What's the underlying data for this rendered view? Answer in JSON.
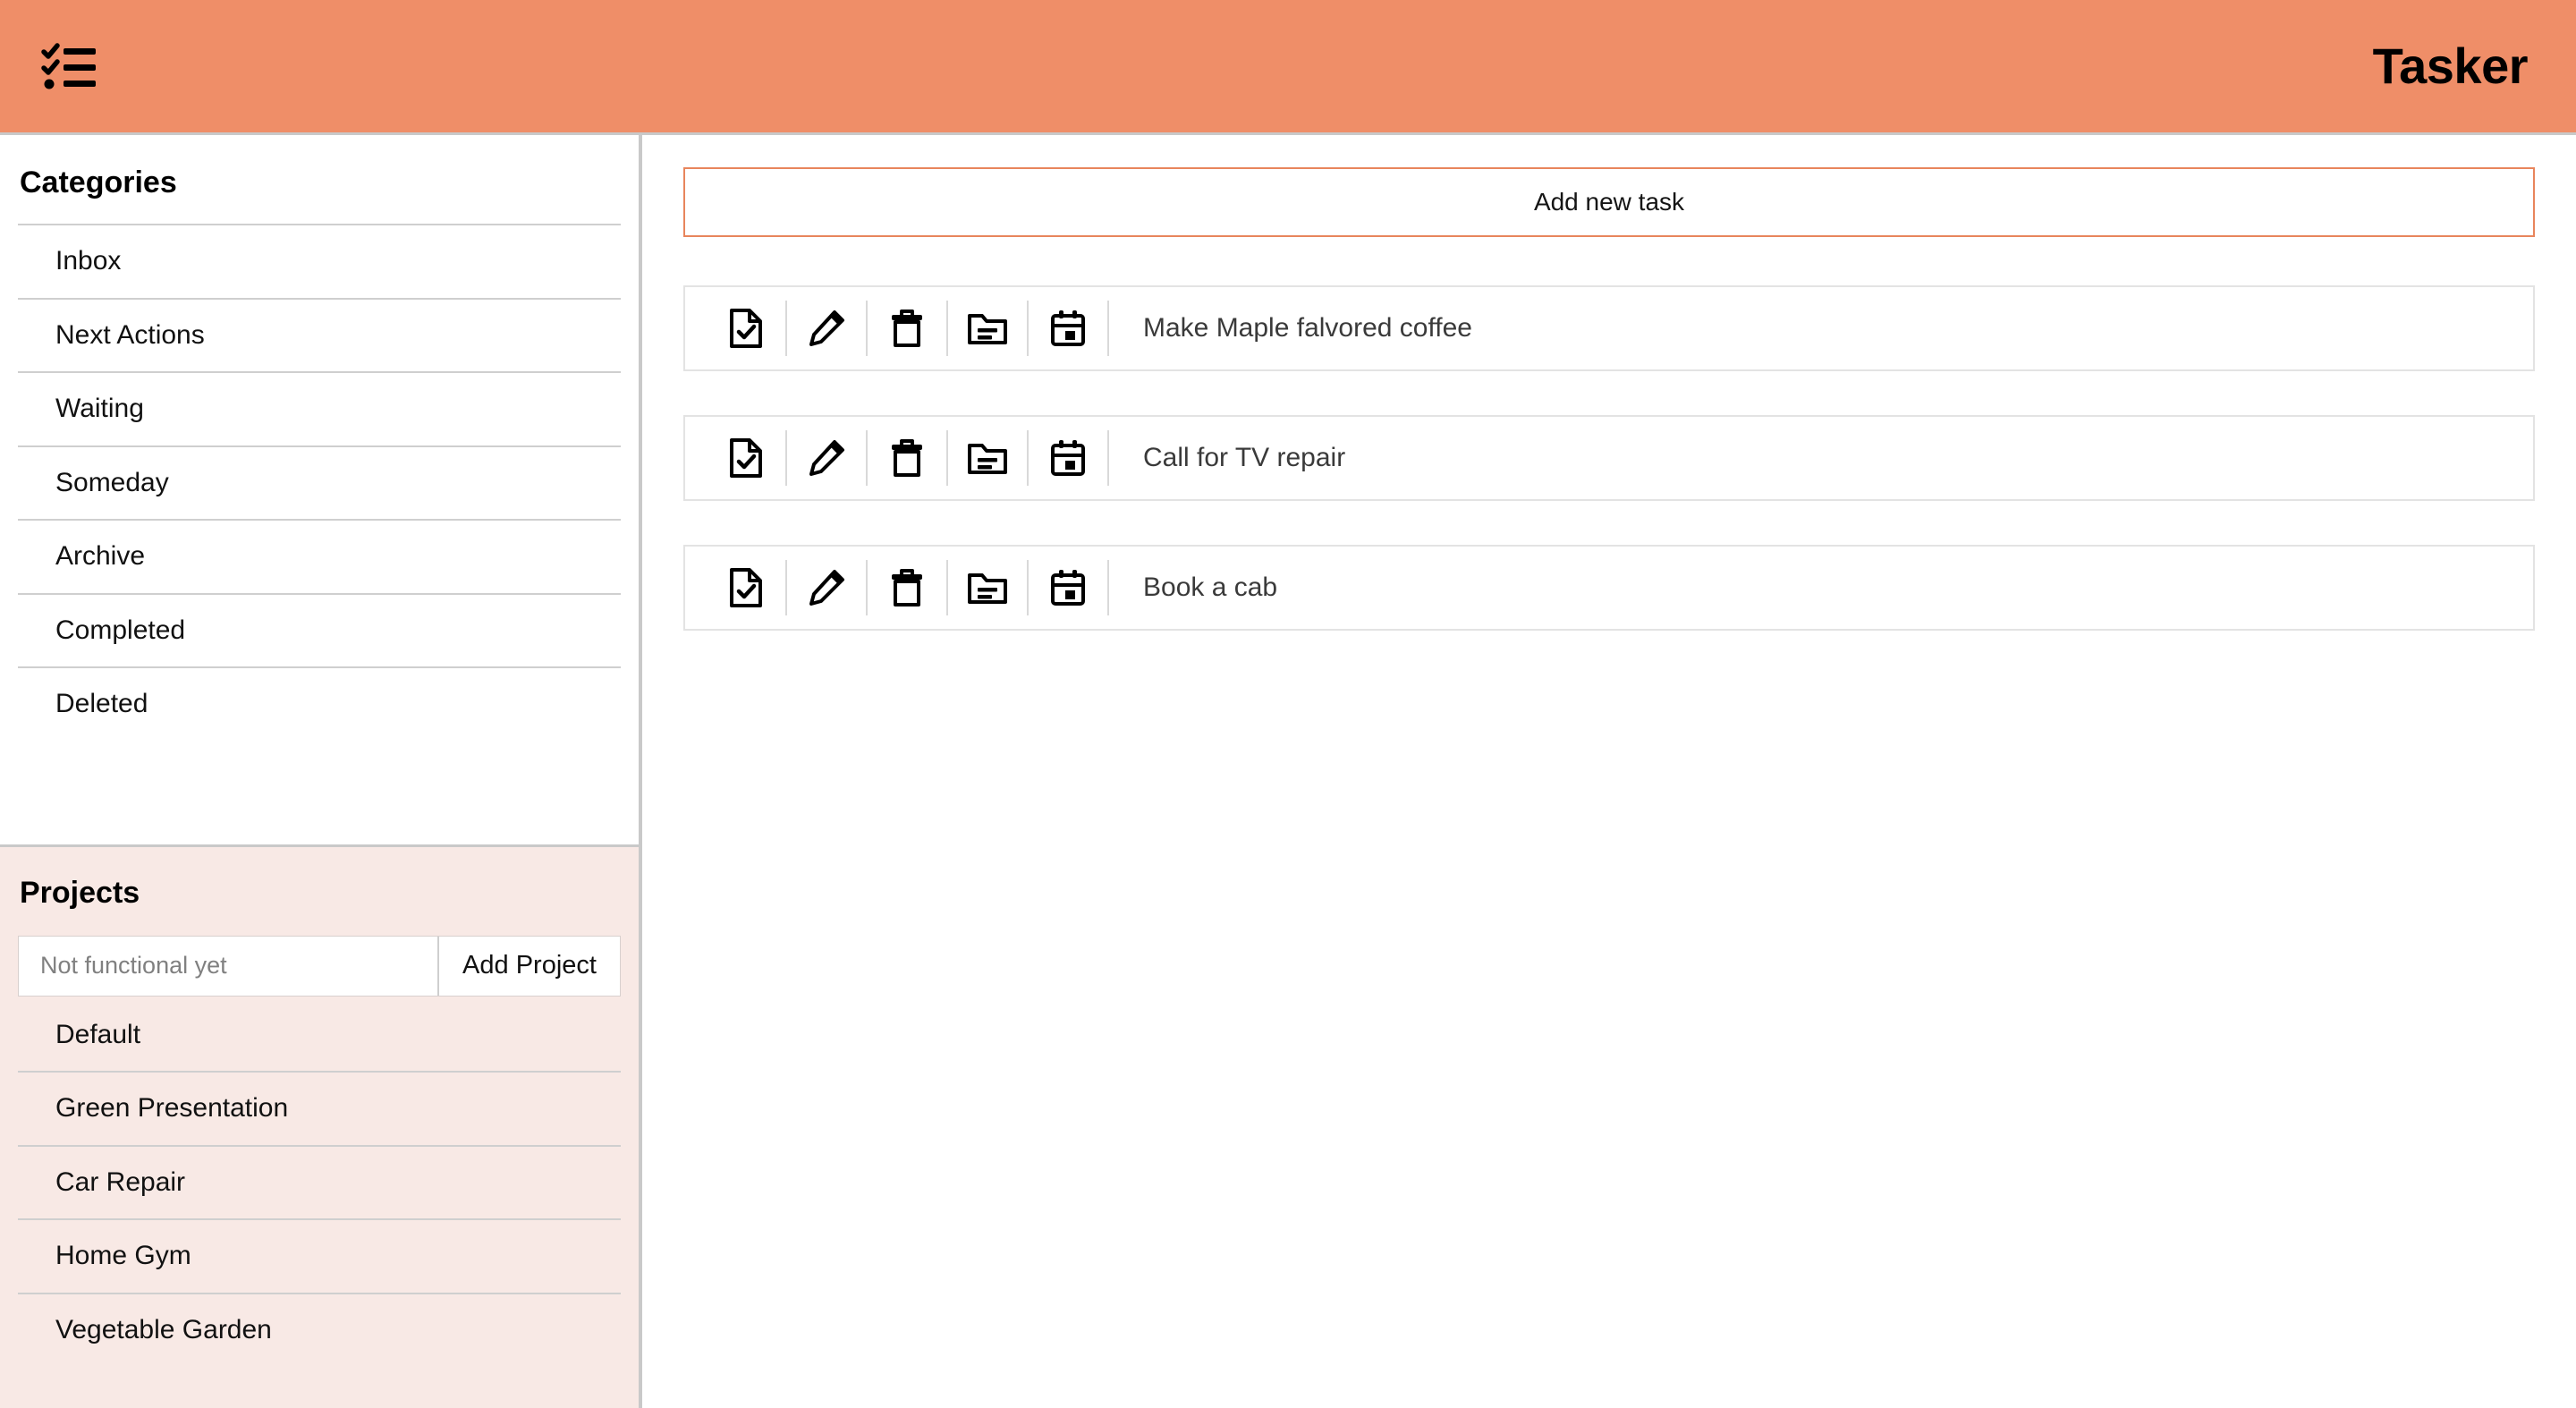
{
  "theme": {
    "header_bg": "#ef8e68",
    "accent_border": "#e8855c",
    "projects_bg": "#f8e9e5",
    "divider": "#c9c9c9",
    "task_border": "#e3e3e3"
  },
  "header": {
    "title": "Tasker",
    "menu_icon": "checklist-icon"
  },
  "sidebar": {
    "categories": {
      "heading": "Categories",
      "items": [
        {
          "label": "Inbox"
        },
        {
          "label": "Next Actions"
        },
        {
          "label": "Waiting"
        },
        {
          "label": "Someday"
        },
        {
          "label": "Archive"
        },
        {
          "label": "Completed"
        },
        {
          "label": "Deleted"
        }
      ]
    },
    "projects": {
      "heading": "Projects",
      "input_value": "",
      "input_placeholder": "Not functional yet",
      "add_button_label": "Add Project",
      "items": [
        {
          "label": "Default"
        },
        {
          "label": "Green Presentation"
        },
        {
          "label": "Car Repair"
        },
        {
          "label": "Home Gym"
        },
        {
          "label": "Vegetable Garden"
        }
      ]
    }
  },
  "main": {
    "add_task_label": "Add new task",
    "action_icons": [
      "document-check-icon",
      "pencil-icon",
      "trash-icon",
      "folder-open-icon",
      "calendar-icon"
    ],
    "tasks": [
      {
        "title": "Make Maple falvored coffee"
      },
      {
        "title": "Call for TV repair"
      },
      {
        "title": "Book a cab"
      }
    ]
  }
}
